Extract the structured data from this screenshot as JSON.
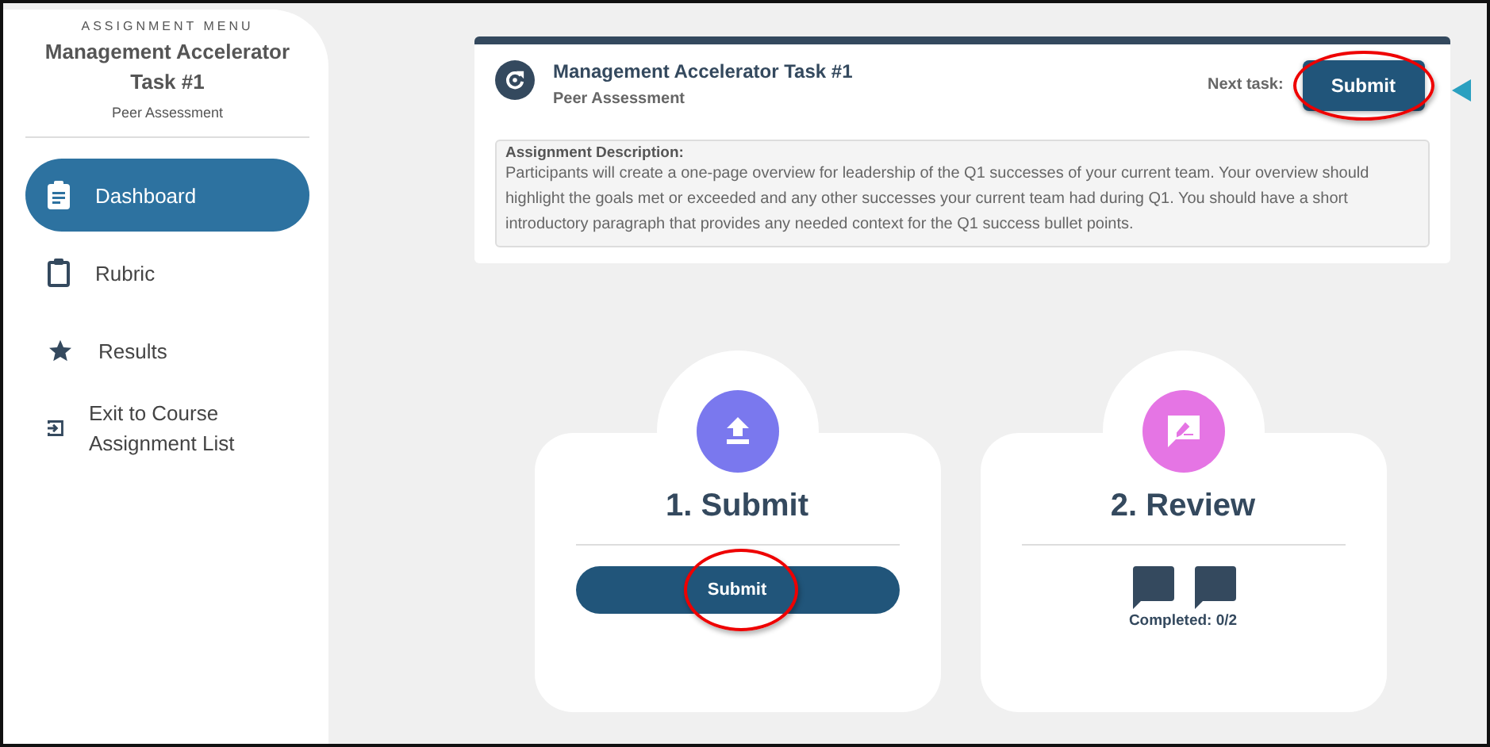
{
  "sidebar": {
    "overline": "ASSIGNMENT MENU",
    "title": "Management Accelerator Task #1",
    "subtitle": "Peer Assessment",
    "items": [
      {
        "kind": "dashboard",
        "label": "Dashboard",
        "selected": true
      },
      {
        "kind": "rubric",
        "label": "Rubric",
        "selected": false
      },
      {
        "kind": "results",
        "label": "Results",
        "selected": false
      },
      {
        "kind": "exit",
        "label": "Exit to Course Assignment List",
        "selected": false
      }
    ]
  },
  "header": {
    "title": "Management Accelerator Task #1",
    "subtitle": "Peer Assessment",
    "next_label": "Next task:",
    "next_button": "Submit",
    "highlighted": true,
    "description_label": "Assignment Description:",
    "description": "Participants will create a one-page overview for leadership of the Q1 successes of your current team. Your overview should highlight the goals met or exceeded and any other successes your current team had during Q1. You should have a short introductory paragraph that provides any needed context for the Q1 success bullet points."
  },
  "steps": [
    {
      "kind": "submit",
      "title": "1. Submit",
      "color": "#7a78ee",
      "button": "Submit",
      "highlighted": true
    },
    {
      "kind": "review",
      "title": "2. Review",
      "color": "#e575e4",
      "status": "Completed: 0/2"
    }
  ]
}
